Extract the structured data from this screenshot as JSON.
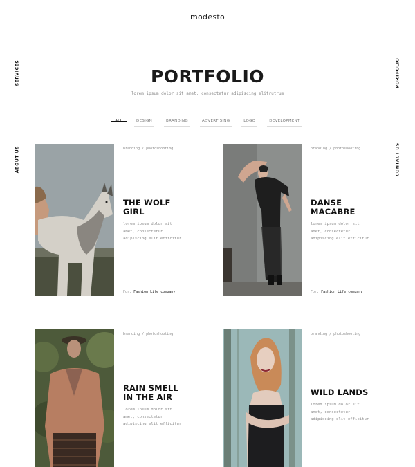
{
  "brand": {
    "logo": "modesto"
  },
  "side_nav": {
    "left_top": "SERVICES",
    "left_bottom": "ABOUT US",
    "right_top": "PORTFOLIO",
    "right_bottom": "CONTACT US"
  },
  "header": {
    "title": "PORTFOLIO",
    "subtitle": "lorem ipsum dolor sit amet, consectetur adipiscing elitrutrum"
  },
  "filters": [
    "ALL",
    "DESIGN",
    "BRANDING",
    "ADVERTISING",
    "LOGO",
    "DEVELOPMENT"
  ],
  "active_filter": "ALL",
  "projects": [
    {
      "category": "branding / photoshooting",
      "title_line1": "THE WOLF",
      "title_line2": "GIRL",
      "desc_line1": "lorem ipsum dolor sit",
      "desc_line2": "amet, consectetur",
      "desc_line3": "adipiscing elit efficitur",
      "for_label": "For:",
      "client": "Fashion Life company"
    },
    {
      "category": "branding / photoshooting",
      "title_line1": "DANSE",
      "title_line2": "MACABRE",
      "desc_line1": "lorem ipsum dolor sit",
      "desc_line2": "amet, consectetur",
      "desc_line3": "adipiscing elit efficitur",
      "for_label": "For:",
      "client": "Fashion Life company"
    },
    {
      "category": "branding / photoshooting",
      "title_line1": "RAIN SMELL",
      "title_line2": "IN THE AIR",
      "desc_line1": "lorem ipsum dolor sit",
      "desc_line2": "amet, consectetur",
      "desc_line3": "adipiscing elit efficitur"
    },
    {
      "category": "branding / photoshooting",
      "title_line1": "WILD LANDS",
      "title_line2": "",
      "desc_line1": "lorem ipsum dolor sit",
      "desc_line2": "amet, consectetur",
      "desc_line3": "adipiscing elit efficitur"
    }
  ],
  "colors": {
    "text": "#111111",
    "muted": "#8a8a8a",
    "rule": "#dcdcdc",
    "background": "#ffffff"
  }
}
